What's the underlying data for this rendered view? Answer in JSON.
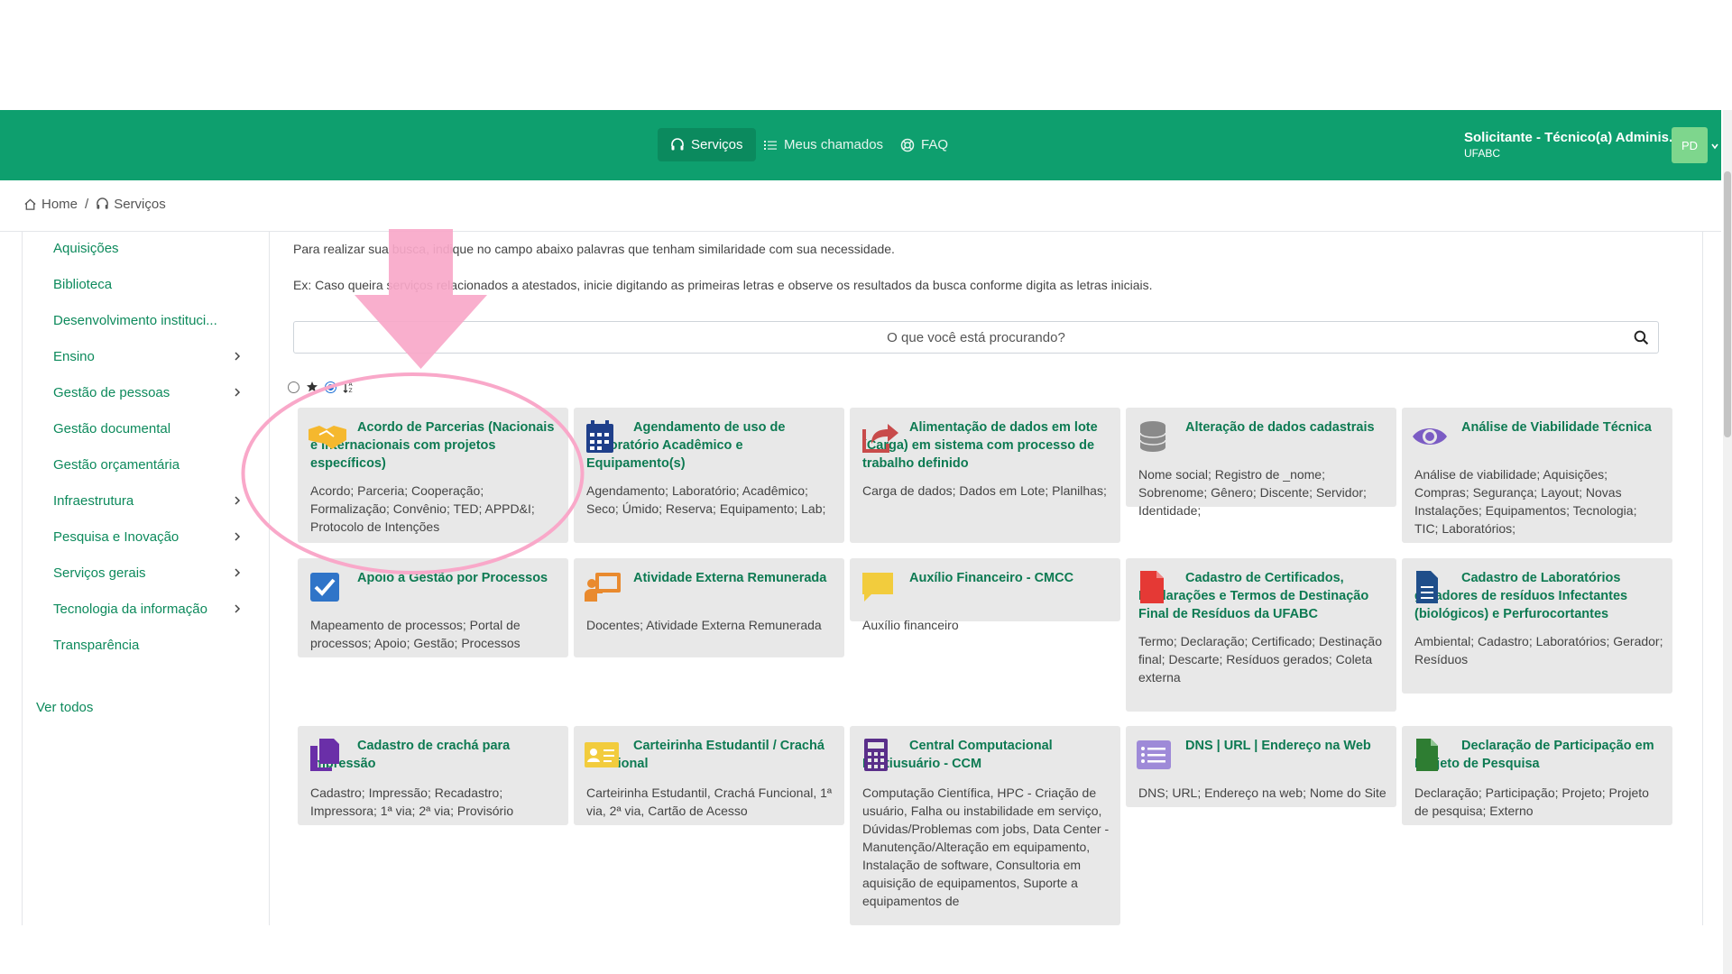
{
  "nav": {
    "items": [
      {
        "label": "Serviços",
        "icon": "headset-icon",
        "active": true
      },
      {
        "label": "Meus chamados",
        "icon": "list-icon",
        "active": false
      },
      {
        "label": "FAQ",
        "icon": "lifebuoy-icon",
        "active": false
      }
    ],
    "user": {
      "role": "Solicitante - Técnico(a) Adminis...",
      "org": "UFABC",
      "initials": "PD"
    }
  },
  "breadcrumb": {
    "home": "Home",
    "separator": "/",
    "current": "Serviços"
  },
  "sidebar": {
    "items": [
      {
        "label": "Aquisições",
        "has_children": false
      },
      {
        "label": "Biblioteca",
        "has_children": false
      },
      {
        "label": "Desenvolvimento instituci...",
        "has_children": false
      },
      {
        "label": "Ensino",
        "has_children": true
      },
      {
        "label": "Gestão de pessoas",
        "has_children": true
      },
      {
        "label": "Gestão documental",
        "has_children": false
      },
      {
        "label": "Gestão orçamentária",
        "has_children": false
      },
      {
        "label": "Infraestrutura",
        "has_children": true
      },
      {
        "label": "Pesquisa e Inovação",
        "has_children": true
      },
      {
        "label": "Serviços gerais",
        "has_children": true
      },
      {
        "label": "Tecnologia da informação",
        "has_children": true
      },
      {
        "label": "Transparência",
        "has_children": false
      }
    ],
    "see_all": "Ver todos"
  },
  "main": {
    "intro_1": "Para realizar sua busca, indique no campo abaixo palavras que tenham similaridade com sua necessidade.",
    "intro_2": "Ex: Caso queira serviços relacionados a atestados, inicie digitando as primeiras letras e observe os resultados da busca conforme digita as letras iniciais.",
    "search_placeholder": "O que você está procurando?",
    "sort_selected": "alphabetical"
  },
  "cards": [
    {
      "title": "Acordo de Parcerias (Nacionais e Internacionais com projetos específicos)",
      "desc": "Acordo; Parceria; Cooperação; Formalização; Convênio; TED; APPD&I; Protocolo de Intenções",
      "icon": "handshake-icon",
      "color": "#f5b82e"
    },
    {
      "title": "Agendamento de uso de Laboratório Acadêmico e Equipamento(s)",
      "desc": "Agendamento; Laboratório; Acadêmico; Seco; Úmido; Reserva; Equipamento; Lab;",
      "icon": "calendar-icon",
      "color": "#1f3f8a"
    },
    {
      "title": "Alimentação de dados em lote (Carga) em sistema com processo de trabalho definido",
      "desc": "Carga de dados; Dados em Lote; Planilhas;",
      "icon": "share-icon",
      "color": "#c84b4b"
    },
    {
      "title": "Alteração de dados cadastrais",
      "desc": "Nome social; Registro de _nome; Sobrenome; Gênero; Discente; Servidor; Identidade;",
      "icon": "database-icon",
      "color": "#8a8a8a"
    },
    {
      "title": "Análise de Viabilidade Técnica",
      "desc": "Análise de viabilidade; Aquisições; Compras; Segurança; Layout; Novas Instalações; Equipamentos; Tecnologia; TIC; Laboratórios;",
      "icon": "eye-icon",
      "color": "#7b5cc4"
    },
    {
      "title": "Apoio à Gestão por Processos",
      "desc": "Mapeamento de processos; Portal de processos; Apoio; Gestão; Processos",
      "icon": "checkbox-icon",
      "color": "#2f74c8"
    },
    {
      "title": "Atividade Externa Remunerada",
      "desc": "Docentes; Atividade Externa Remunerada",
      "icon": "teacher-icon",
      "color": "#e98a2e"
    },
    {
      "title": "Auxílio Financeiro - CMCC",
      "desc": "Auxílio financeiro",
      "icon": "chat-icon",
      "color": "#f2cc3d"
    },
    {
      "title": "Cadastro de Certificados, Declarações e Termos de Destinação Final de Resíduos da UFABC",
      "desc": "Termo; Declaração; Certificado; Destinação final; Descarte; Resíduos gerados; Coleta externa",
      "icon": "pdf-file-icon",
      "color": "#e53935"
    },
    {
      "title": "Cadastro de Laboratórios geradores de resíduos Infectantes (biológicos) e Perfurocortantes",
      "desc": "Ambiental; Cadastro; Laboratórios; Gerador; Resíduos",
      "icon": "document-icon",
      "color": "#1f4e8a"
    },
    {
      "title": "Cadastro de crachá para impressão",
      "desc": "Cadastro; Impressão; Recadastro; Impressora; 1ª via; 2ª via; Provisório",
      "icon": "copy-icon",
      "color": "#6a2fa8"
    },
    {
      "title": "Carteirinha Estudantil / Crachá Funcional",
      "desc": "Carteirinha Estudantil, Crachá Funcional, 1ª via, 2ª via, Cartão de Acesso",
      "icon": "id-card-icon",
      "color": "#f2cc3d"
    },
    {
      "title": "Central Computacional Multiusuário - CCM",
      "desc": "Computação Científica, HPC - Criação de usuário, Falha ou instabilidade em serviço, Dúvidas/Problemas com jobs, Data Center - Manutenção/Alteração em equipamento, Instalação de software, Consultoria em aquisição de equipamentos, Suporte a equipamentos de",
      "icon": "calculator-icon",
      "color": "#5a2f8a"
    },
    {
      "title": "DNS | URL | Endereço na Web",
      "desc": "DNS; URL; Endereço na web; Nome do Site",
      "icon": "list-box-icon",
      "color": "#9e8ad8"
    },
    {
      "title": "Declaração de Participação em Projeto de Pesquisa",
      "desc": "Declaração; Participação; Projeto; Projeto de pesquisa; Externo",
      "icon": "file-icon",
      "color": "#2e7d32"
    }
  ],
  "accents": {
    "primary": "#0e9f6e",
    "link": "#0d8a5c",
    "annotation": "#f9a8c9"
  }
}
